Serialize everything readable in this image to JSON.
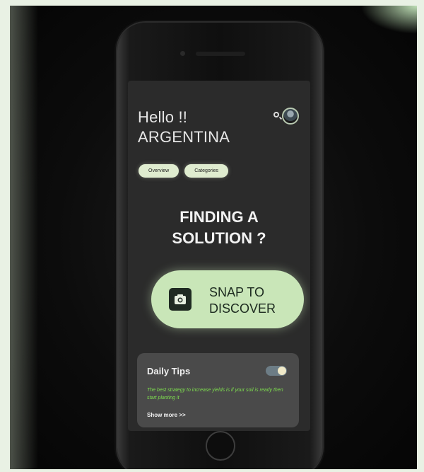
{
  "header": {
    "greeting_line1": "Hello !!",
    "greeting_line2": "ARGENTINA"
  },
  "chips": [
    {
      "label": "Overview"
    },
    {
      "label": "Categories"
    }
  ],
  "headline": {
    "line1": "FINDING A",
    "line2": "SOLUTION ?"
  },
  "snap_button": {
    "line1": "SNAP TO",
    "line2": "DISCOVER"
  },
  "daily_tips": {
    "title": "Daily Tips",
    "text": "The best strategy to increase yields is if your soil is ready then start planting it",
    "show_more": "Show more >>"
  },
  "icons": {
    "search": "search-icon",
    "avatar": "avatar",
    "camera": "camera-icon",
    "toggle": "toggle-switch"
  },
  "colors": {
    "accent_green": "#c9e6b8",
    "chip_bg": "#dfeccf",
    "screen_bg": "#2b2b2b",
    "card_bg": "#4a4a4a",
    "tip_text": "#7fe04f"
  }
}
